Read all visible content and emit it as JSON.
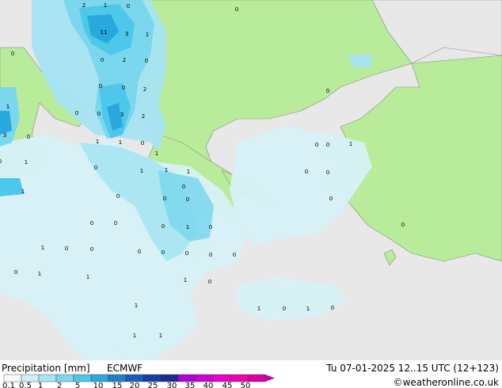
{
  "legend": {
    "title": "Precipitation [mm]",
    "model": "ECMWF",
    "ticks": [
      "0.1",
      "0.5",
      "1",
      "2",
      "5",
      "10",
      "15",
      "20",
      "25",
      "30",
      "35",
      "40",
      "45",
      "50"
    ],
    "colors": [
      "#f5fbfd",
      "#cdeef6",
      "#a6e4f2",
      "#7ad7ee",
      "#4dc7ea",
      "#28a8dc",
      "#1f7fcc",
      "#1c5cb8",
      "#1a3ea6",
      "#1b2a93",
      "#b000d8",
      "#d000d0",
      "#e800c8",
      "#f000b0",
      "#d800a0"
    ]
  },
  "valid_time": "Tu 07-01-2025 12..15 UTC (12+123)",
  "credit": "©weatheronline.co.uk",
  "map_labels": [
    {
      "t": "2"
    },
    {
      "t": "1"
    },
    {
      "t": "0"
    },
    {
      "t": "0"
    },
    {
      "t": "11"
    },
    {
      "t": "3"
    },
    {
      "t": "1"
    },
    {
      "t": "0"
    },
    {
      "t": "0"
    },
    {
      "t": "2"
    },
    {
      "t": "0"
    },
    {
      "t": "0"
    },
    {
      "t": "0"
    },
    {
      "t": "2"
    },
    {
      "t": "1"
    },
    {
      "t": "0"
    },
    {
      "t": "0"
    },
    {
      "t": "3"
    },
    {
      "t": "2"
    },
    {
      "t": "3"
    },
    {
      "t": "0"
    },
    {
      "t": "0"
    },
    {
      "t": "1"
    },
    {
      "t": "1"
    },
    {
      "t": "0"
    },
    {
      "t": "0"
    },
    {
      "t": "0"
    },
    {
      "t": "1"
    },
    {
      "t": "0"
    },
    {
      "t": "1"
    },
    {
      "t": "1"
    },
    {
      "t": "1"
    },
    {
      "t": "1"
    },
    {
      "t": "1"
    },
    {
      "t": "1"
    },
    {
      "t": "0"
    },
    {
      "t": "0"
    },
    {
      "t": "0"
    },
    {
      "t": "0"
    },
    {
      "t": "0"
    },
    {
      "t": "0"
    },
    {
      "t": "0"
    },
    {
      "t": "0"
    },
    {
      "t": "0"
    },
    {
      "t": "0"
    },
    {
      "t": "0"
    },
    {
      "t": "1"
    },
    {
      "t": "0"
    },
    {
      "t": "0"
    },
    {
      "t": "1"
    },
    {
      "t": "0"
    },
    {
      "t": "0"
    },
    {
      "t": "0"
    },
    {
      "t": "0"
    },
    {
      "t": "0"
    },
    {
      "t": "0"
    },
    {
      "t": "0"
    },
    {
      "t": "0"
    },
    {
      "t": "1"
    },
    {
      "t": "1"
    },
    {
      "t": "1"
    },
    {
      "t": "0"
    },
    {
      "t": "1"
    },
    {
      "t": "0"
    },
    {
      "t": "1"
    },
    {
      "t": "0"
    },
    {
      "t": "1"
    },
    {
      "t": "1"
    },
    {
      "t": "1"
    }
  ]
}
